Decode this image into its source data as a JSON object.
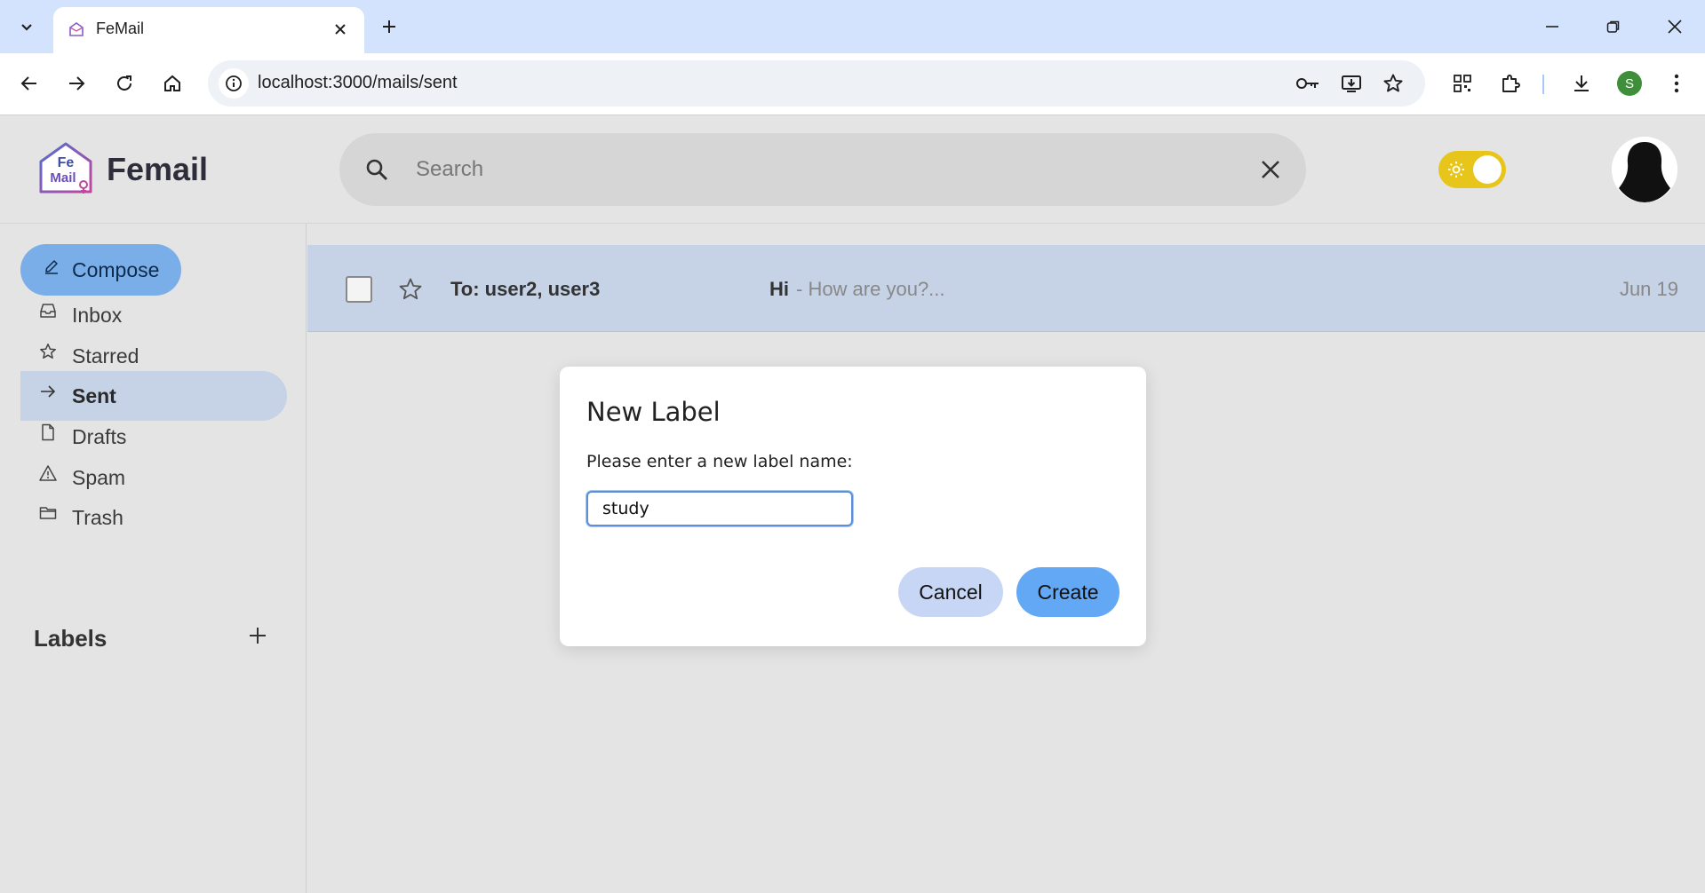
{
  "browser": {
    "tab_title": "FeMail",
    "url": "localhost:3000/mails/sent",
    "profile_initial": "S"
  },
  "app": {
    "brand": "Femail",
    "logo_text_top": "Fe",
    "logo_text_bottom": "Mail",
    "search_placeholder": "Search",
    "search_value": "",
    "theme": "light"
  },
  "sidebar": {
    "compose_label": "Compose",
    "items": [
      {
        "label": "Inbox",
        "icon": "inbox-icon",
        "active": false
      },
      {
        "label": "Starred",
        "icon": "star-icon",
        "active": false
      },
      {
        "label": "Sent",
        "icon": "send-arrow-icon",
        "active": true
      },
      {
        "label": "Drafts",
        "icon": "file-icon",
        "active": false
      },
      {
        "label": "Spam",
        "icon": "warning-icon",
        "active": false
      },
      {
        "label": "Trash",
        "icon": "folder-icon",
        "active": false
      }
    ],
    "labels_heading": "Labels"
  },
  "mails": [
    {
      "to": "To: user2, user3",
      "subject": "Hi",
      "snippet": "- How are you?...",
      "date": "Jun 19",
      "starred": false,
      "selected": false
    }
  ],
  "modal": {
    "title": "New Label",
    "prompt": "Please enter a new label name:",
    "input_value": "study",
    "cancel_label": "Cancel",
    "create_label": "Create"
  },
  "colors": {
    "tabstrip": "#d3e3fd",
    "compose": "#7aaee8",
    "active_nav": "#c6d2e6",
    "toggle": "#e8c51a",
    "create_button": "#62a8f4",
    "cancel_button": "#c8d6f6"
  }
}
